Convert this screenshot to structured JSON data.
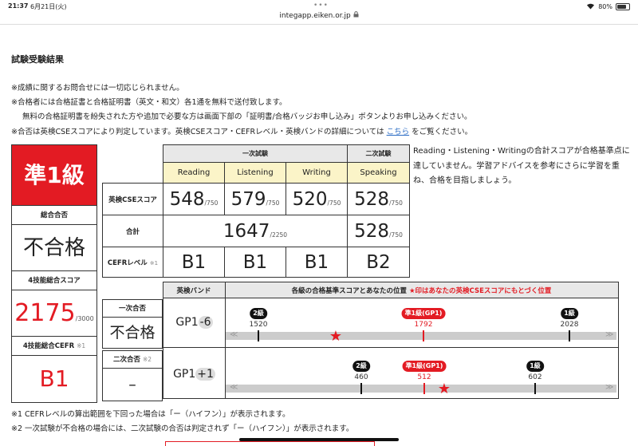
{
  "status": {
    "time": "21:37",
    "date": "6月21日(火)",
    "battery": "80%",
    "battery_level": 0.8
  },
  "browser": {
    "url": "integapp.eiken.or.jp"
  },
  "section_title": "試験受験結果",
  "notes": [
    "※成績に関するお問合せには一切応じられません。",
    "※合格者には合格証書と合格証明書（英文・和文）各1通を無料で送付致します。",
    "無料の合格証明書を紛失された方や追加で必要な方は画面下部の「証明書/合格バッジお申し込み」ボタンよりお申し込みください。",
    "※合否は英検CSEスコアにより判定しています。英検CSEスコア・CEFRレベル・英検バンドの詳細については"
  ],
  "notes_link": "こちら",
  "notes_tail": "をご覧ください。",
  "summary": {
    "grade": "準1級",
    "overall_label": "総合合否",
    "overall_result": "不合格",
    "total4_label": "4技能総合スコア",
    "total4_score": "2175",
    "total4_max": "/3000",
    "cefr4_label": "4技能総合CEFR",
    "cefr4_note": "※1",
    "cefr4_value": "B1"
  },
  "score_table": {
    "first_stage": "一次試験",
    "second_stage": "二次試験",
    "skills": [
      "Reading",
      "Listening",
      "Writing",
      "Speaking"
    ],
    "cse_label": "英検CSEスコア",
    "scores": [
      "548",
      "579",
      "520",
      "528"
    ],
    "score_max": "/750",
    "total_label": "合計",
    "first_total": "1647",
    "first_total_max": "/2250",
    "second_total": "528",
    "second_total_max": "/750",
    "cefr_label": "CEFRレベル",
    "cefr_note": "※1",
    "cefr": [
      "B1",
      "B1",
      "B1",
      "B2"
    ]
  },
  "comment": "Reading・Listening・Writingの合計スコアが合格基準点に達していません。学習アドバイスを参考にさらに学習を重ね、合格を目指しましょう。",
  "band_table": {
    "band_header": "英検バンド",
    "position_header": "各級の合格基準スコアとあなたの位置",
    "position_note": "★印はあなたの英検CSEスコアにもとづく位置",
    "first": {
      "label": "一次合否",
      "result": "不合格",
      "band": "GP1",
      "band_delta": "-6",
      "markers": [
        {
          "label": "2級",
          "score": "1520",
          "red": false
        },
        {
          "label": "準1級(GP1)",
          "score": "1792",
          "red": true
        },
        {
          "label": "1級",
          "score": "2028",
          "red": false
        }
      ]
    },
    "second": {
      "label": "二次合否",
      "note": "※2",
      "result": "–",
      "band": "GP1",
      "band_delta": "+1",
      "markers": [
        {
          "label": "2級",
          "score": "460",
          "red": false
        },
        {
          "label": "準1級(GP1)",
          "score": "512",
          "red": true
        },
        {
          "label": "1級",
          "score": "602",
          "red": false
        }
      ]
    }
  },
  "footnotes": [
    "※1 CEFRレベルの算出範囲を下回った場合は「ー（ハイフン）」が表示されます。",
    "※2 一次試験が不合格の場合には、二次試験の合否は判定されず「ー（ハイフン）」が表示されます。"
  ],
  "colors": {
    "accent_red": "#e31b23",
    "header_gray": "#e8e8e8",
    "skill_yellow": "#fbf4c8",
    "link_blue": "#2b6cc4"
  }
}
